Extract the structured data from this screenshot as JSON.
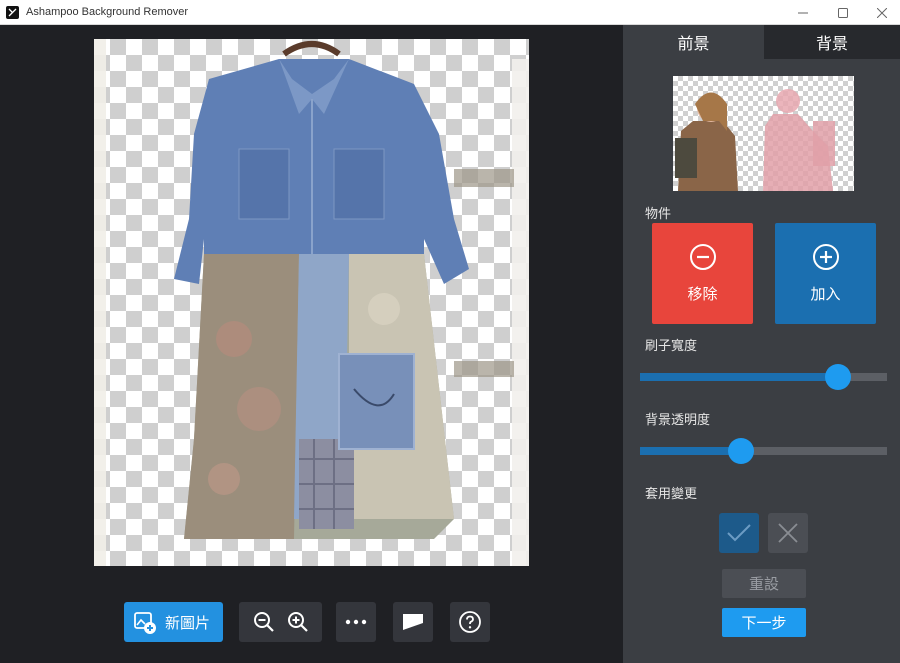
{
  "window": {
    "title": "Ashampoo Background Remover",
    "minimize_icon": "minimize-icon",
    "maximize_icon": "maximize-icon",
    "close_icon": "close-icon"
  },
  "toolbar": {
    "new_image_label": "新圖片"
  },
  "panel": {
    "tabs": [
      {
        "label": "前景",
        "active": true
      },
      {
        "label": "背景",
        "active": false
      }
    ],
    "objects_label": "物件",
    "remove_label": "移除",
    "add_label": "加入",
    "brush_width_label": "刷子寬度",
    "brush_width_value": 0.8,
    "bg_opacity_label": "背景透明度",
    "bg_opacity_value": 0.41,
    "apply_changes_label": "套用變更",
    "reset_label": "重設",
    "next_label": "下一步"
  },
  "colors": {
    "remove": "#e8453c",
    "add": "#1b6fb0",
    "accent": "#2391e0"
  }
}
